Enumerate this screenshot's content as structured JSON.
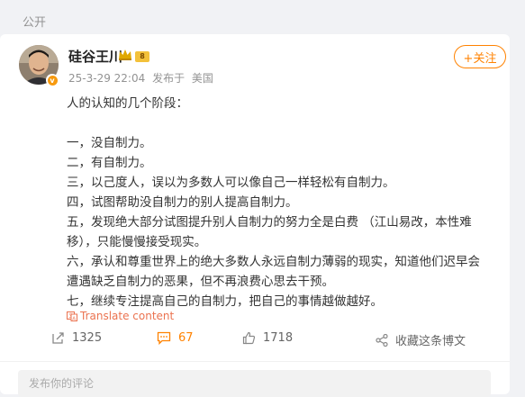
{
  "visibility_label": "公开",
  "post": {
    "author": "硅谷王川",
    "vip_level": "8",
    "timestamp": "25-3-29 22:04",
    "source_prefix": "发布于",
    "location": "美国",
    "follow_label": "+关注",
    "content_lines": [
      "人的认知的几个阶段：",
      "",
      "一，没自制力。",
      "二，有自制力。",
      "三，以己度人，误以为多数人可以像自己一样轻松有自制力。",
      "四，试图帮助没自制力的别人提高自制力。",
      "五，发现绝大部分试图提升别人自制力的努力全是白费 （江山易改，本性难移），只能慢慢接受现实。",
      "六，承认和尊重世界上的绝大多数人永远自制力薄弱的现实，知道他们迟早会遭遇缺乏自制力的恶果，但不再浪费心思去干预。",
      "七，继续专注提高自己的自制力，把自己的事情越做越好。"
    ],
    "translate_label": "Translate content",
    "actions": {
      "repost_count": "1325",
      "comment_count": "67",
      "like_count": "1718",
      "favorite_label": "收藏这条博文"
    },
    "comment_placeholder": "发布你的评论"
  },
  "colors": {
    "accent": "#ff8200",
    "translate": "#eb7350",
    "comment_active": "#ff8200"
  }
}
